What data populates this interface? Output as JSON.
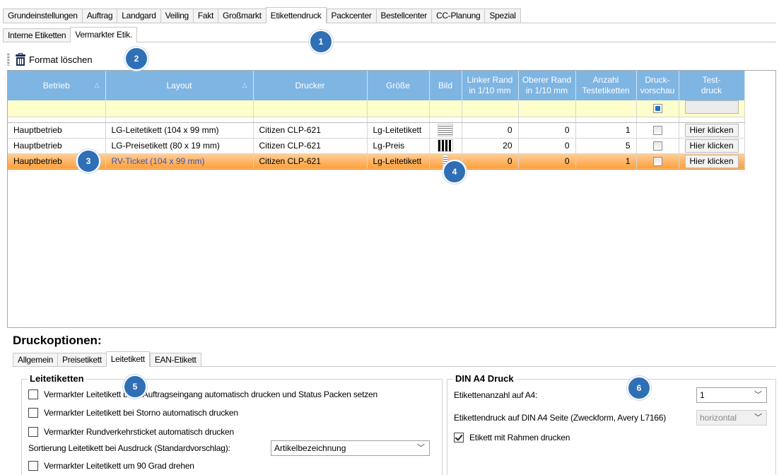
{
  "top_tabs": [
    "Grundeinstellungen",
    "Auftrag",
    "Landgard",
    "Veiling",
    "Fakt",
    "Großmarkt",
    "Etikettendruck",
    "Packcenter",
    "Bestellcenter",
    "CC-Planung",
    "Spezial"
  ],
  "sub_tabs": [
    "Interne Etiketten",
    "Vermarkter Etik."
  ],
  "toolbar": {
    "format_delete_label": "Format löschen"
  },
  "columns": {
    "betrieb": "Betrieb",
    "layout": "Layout",
    "drucker": "Drucker",
    "groesse": "Größe",
    "bild": "Bild",
    "linker_rand_1": "Linker Rand",
    "linker_rand_2": "in 1/10 mm",
    "oberer_rand_1": "Oberer Rand",
    "oberer_rand_2": "in 1/10 mm",
    "anzahl_1": "Anzahl",
    "anzahl_2": "Testetiketten",
    "vorschau_1": "Druck-",
    "vorschau_2": "vorschau",
    "testdruck_1": "Test-",
    "testdruck_2": "druck",
    "sort_icon": "△"
  },
  "rows": [
    {
      "betrieb": "Hauptbetrieb",
      "layout": "LG-Leitetikett (104 x 99 mm)",
      "drucker": "Citizen CLP-621",
      "groesse": "Lg-Leitetikett",
      "linker": "0",
      "oberer": "0",
      "anzahl": "1",
      "button": "Hier klicken"
    },
    {
      "betrieb": "Hauptbetrieb",
      "layout": "LG-Preisetikett (80 x 19 mm)",
      "drucker": "Citizen CLP-621",
      "groesse": "Lg-Preis",
      "linker": "20",
      "oberer": "0",
      "anzahl": "5",
      "button": "Hier klicken"
    },
    {
      "betrieb": "Hauptbetrieb",
      "layout": "RV-Ticket (104 x 99 mm)",
      "drucker": "Citizen CLP-621",
      "groesse": "Lg-Leitetikett",
      "linker": "0",
      "oberer": "0",
      "anzahl": "1",
      "button": "Hier klicken"
    }
  ],
  "options": {
    "title": "Druckoptionen:",
    "tabs": [
      "Allgemein",
      "Preisetikett",
      "Leitetikett",
      "EAN-Etikett"
    ],
    "leit": {
      "legend": "Leitetiketten",
      "cb1": "Vermarkter Leitetikett  beim Auftragseingang automatisch drucken und Status Packen setzen",
      "cb2": "Vermarkter Leitetikett bei Storno automatisch drucken",
      "cb3": "Vermarkter Rundverkehrsticket automatisch drucken",
      "sort_label": "Sortierung Leitetikett bei Ausdruck (Standardvorschlag):",
      "sort_value": "Artikelbezeichnung",
      "cb4": "Vermarkter Leitetikett um 90 Grad drehen"
    },
    "din": {
      "legend": "DIN A4 Druck",
      "count_label": "Etikettenanzahl auf A4:",
      "count_value": "1",
      "page_label": "Etikettendruck auf DIN A4 Seite (Zweckform, Avery L7166)",
      "page_value": "horizontal",
      "frame_label": "Etikett mit Rahmen drucken"
    }
  },
  "markers": [
    "1",
    "2",
    "3",
    "4",
    "5",
    "6"
  ],
  "colors": {
    "header": "#7fb5e3",
    "selected_row": "#ff9f3a",
    "filter_row": "#ffffcc",
    "marker": "#2f6fb5"
  }
}
